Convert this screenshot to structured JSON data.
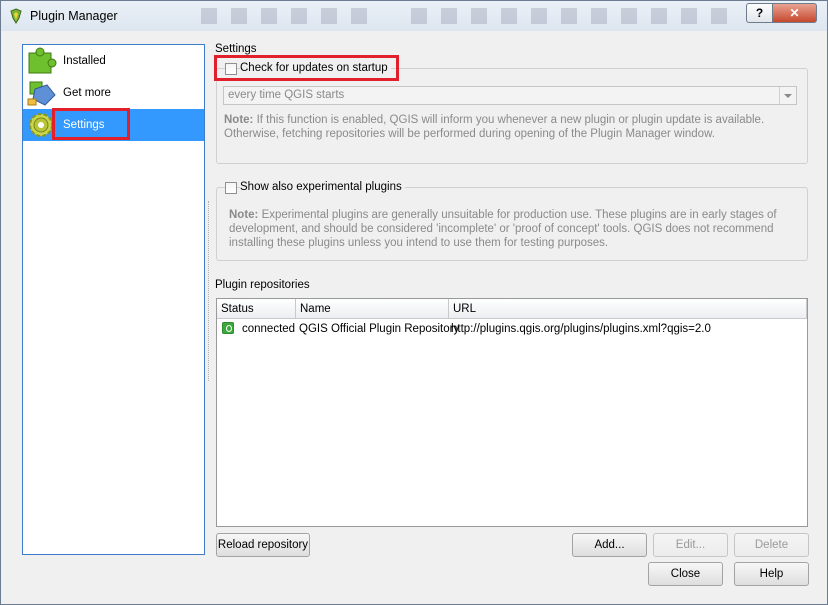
{
  "window": {
    "title": "Plugin Manager",
    "help_label": "?",
    "close_label": "✕"
  },
  "sidebar": {
    "items": [
      {
        "label": "Installed",
        "icon": "puzzle-green-icon"
      },
      {
        "label": "Get more",
        "icon": "puzzle-blue-icon"
      },
      {
        "label": "Settings",
        "icon": "gear-icon",
        "selected": true
      }
    ]
  },
  "settings": {
    "section_label": "Settings",
    "check_updates": {
      "label": "Check for updates on startup",
      "checked": false
    },
    "frequency": {
      "value": "every time QGIS starts"
    },
    "updates_note_prefix": "Note:",
    "updates_note_text": " If this function is enabled, QGIS will inform you whenever a new plugin or plugin update is available. Otherwise, fetching repositories will be performed during opening of the Plugin Manager window.",
    "experimental": {
      "label": "Show also experimental plugins",
      "checked": false
    },
    "experimental_note_prefix": "Note:",
    "experimental_note_text": " Experimental plugins are generally unsuitable for production use. These plugins are in early stages of development, and should be considered 'incomplete' or 'proof of concept' tools. QGIS does not recommend installing these plugins unless you intend to use them for testing purposes."
  },
  "repositories": {
    "section_label": "Plugin repositories",
    "columns": [
      "Status",
      "Name",
      "URL"
    ],
    "rows": [
      {
        "status": "connected",
        "name": "QGIS Official Plugin Repository",
        "url": "http://plugins.qgis.org/plugins/plugins.xml?qgis=2.0"
      }
    ]
  },
  "buttons": {
    "reload": "Reload repository",
    "add": "Add...",
    "edit": "Edit...",
    "delete": "Delete",
    "close": "Close",
    "help": "Help"
  },
  "colors": {
    "selection": "#3399ff",
    "highlight_box": "#e2202b",
    "status_ok": "#3aa83a"
  }
}
